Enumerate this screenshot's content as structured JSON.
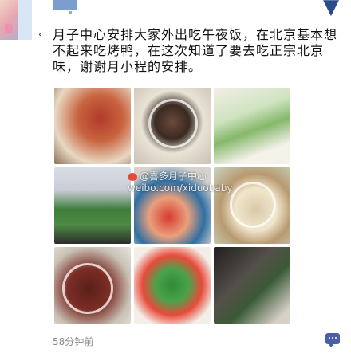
{
  "post": {
    "text": "月子中心安排大家外出吃午夜饭，在北京基本想不起来吃烤鸭，在这次知道了要去吃正宗北京味，谢谢月小程的安排。",
    "timestamp": "58分钟前"
  },
  "watermark": {
    "handle": "@喜多月子中心",
    "url": "weibo.com/xiduobaby"
  },
  "photos": [
    {
      "label": "photo-1"
    },
    {
      "label": "photo-2"
    },
    {
      "label": "photo-3"
    },
    {
      "label": "photo-4"
    },
    {
      "label": "photo-5"
    },
    {
      "label": "photo-6"
    },
    {
      "label": "photo-7"
    },
    {
      "label": "photo-8"
    },
    {
      "label": "photo-9"
    }
  ],
  "icons": {
    "corner": "heart-shape-icon",
    "comment": "comment-icon"
  },
  "colors": {
    "accent": "#4a5fa8",
    "timestamp": "#8a8a8a"
  }
}
